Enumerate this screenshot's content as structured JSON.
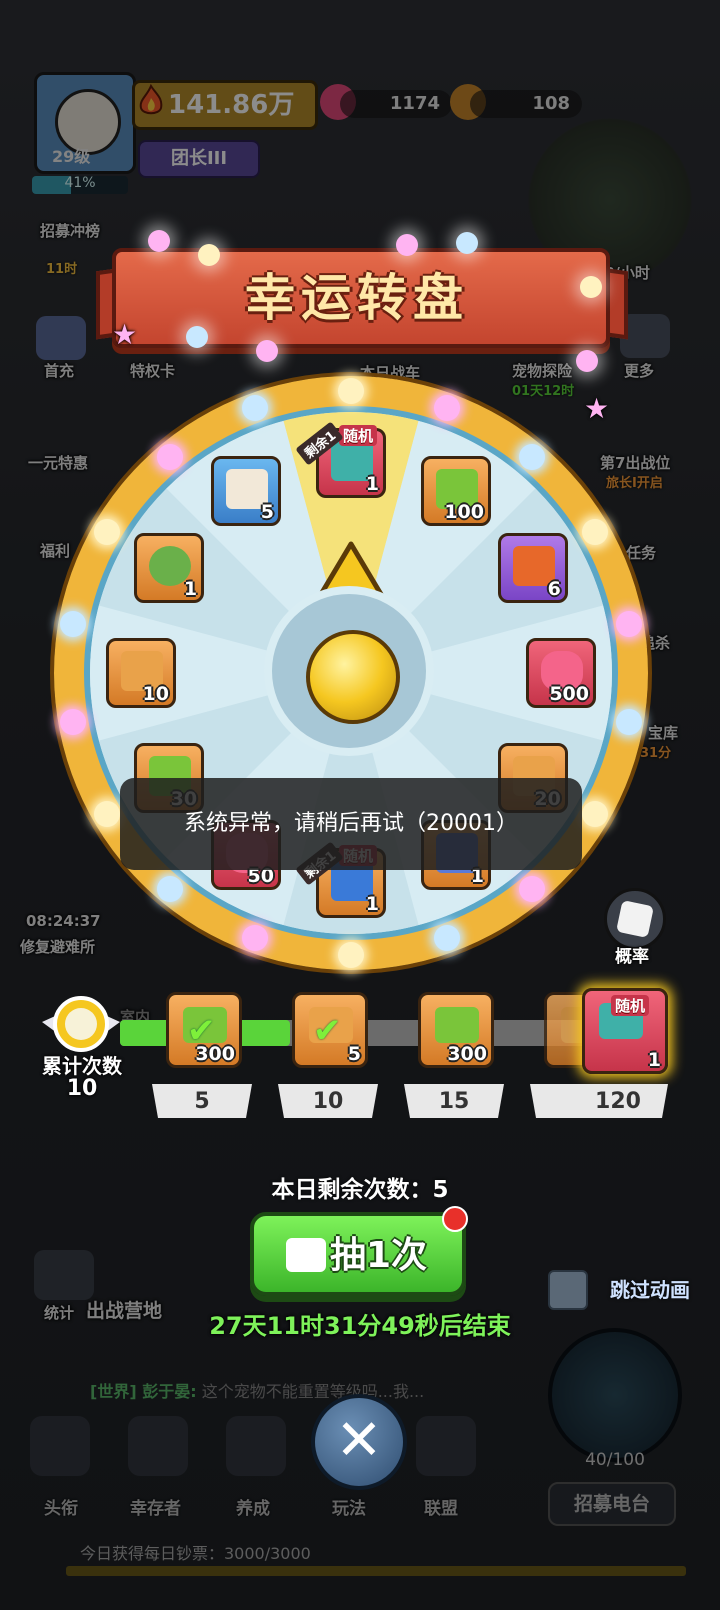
{
  "hud": {
    "level": "29级",
    "xp_percent": "41%",
    "xp_fraction": 0.41,
    "power": "141.86万",
    "rank": "团长III",
    "gems": "1174",
    "tickets": "108"
  },
  "side_left": {
    "recruit_rush": "招募冲榜",
    "recruit_timer": "11时",
    "first_charge": "首充",
    "privilege_card": "特权卡",
    "one_yuan": "一元特惠",
    "welfare": "福利",
    "repair_timer": "08:24:37",
    "repair_label": "修复避难所"
  },
  "side_right": {
    "per_hour": "8/小时",
    "pet_explore": "宠物探险",
    "pet_timer": "01天12时",
    "more": "更多",
    "battle_label": "本日战车",
    "seventh": "第7出战位",
    "seventh_sub": "旅长I开启",
    "task": "任务",
    "kill": "追杀",
    "vault": "宝库",
    "vault_sub": "31分"
  },
  "wheel": {
    "title": "幸运转盘",
    "random_tag": "随机",
    "remaining_tag": "剩余1",
    "items": [
      {
        "icon": "random-chest-icon",
        "count": "1"
      },
      {
        "icon": "cash-stack-icon",
        "count": "100"
      },
      {
        "icon": "spray-can-icon",
        "count": "6"
      },
      {
        "icon": "ruby-gem-icon",
        "count": "500"
      },
      {
        "icon": "ticket-icon",
        "count": "20"
      },
      {
        "icon": "blueprint-icon",
        "count": "1"
      },
      {
        "icon": "random-gold-chest-icon",
        "count": "1"
      },
      {
        "icon": "ruby-gem-icon",
        "count": "50"
      },
      {
        "icon": "cash-stack-icon",
        "count": "30"
      },
      {
        "icon": "ticket-icon",
        "count": "10"
      },
      {
        "icon": "compass-icon",
        "count": "1"
      },
      {
        "icon": "pet-food-bag-icon",
        "count": "5"
      }
    ]
  },
  "toast": "系统异常，请稍后再试（20001）",
  "probability": {
    "label": "概率"
  },
  "progress": {
    "cumulative_label": "累计次数",
    "cumulative_value": "10",
    "fill_fraction": 0.34,
    "milestones": [
      {
        "threshold": "5",
        "reward_icon": "cash-stack-icon",
        "count": "300",
        "claimed": true
      },
      {
        "threshold": "10",
        "reward_icon": "pet-food-icon",
        "count": "5",
        "claimed": true
      },
      {
        "threshold": "15",
        "reward_icon": "cash-stack-icon",
        "count": "300",
        "claimed": false
      },
      {
        "threshold": "",
        "reward_icon": "ticket-icon",
        "count": "",
        "claimed": false
      },
      {
        "threshold": "120",
        "reward_icon": "random-chest-icon",
        "count": "1",
        "claimed": false,
        "tag": "随机"
      }
    ]
  },
  "spin": {
    "remaining": "本日剩余次数：5",
    "button_label": "抽1次",
    "timer": "27天11时31分49秒后结束",
    "skip_label": "跳过动画"
  },
  "background": {
    "stats": "统计",
    "battle_camp": "出战营地",
    "chat_channel": "[世界] 彭于晏:",
    "chat_text": "这个宠物不能重置等级吗...我...",
    "indoor": "室内",
    "radar_count": "40/100",
    "recruit_station": "招募电台",
    "daily_notes": "今日获得每日钞票：3000/3000",
    "nav": [
      "头衔",
      "幸存者",
      "养成",
      "玩法",
      "联盟"
    ]
  },
  "colors": {
    "accent_green": "#5ad43a",
    "banner_red": "#c4452f",
    "wheel_gold": "#f0b53a",
    "timer_green": "#7ef25a"
  }
}
